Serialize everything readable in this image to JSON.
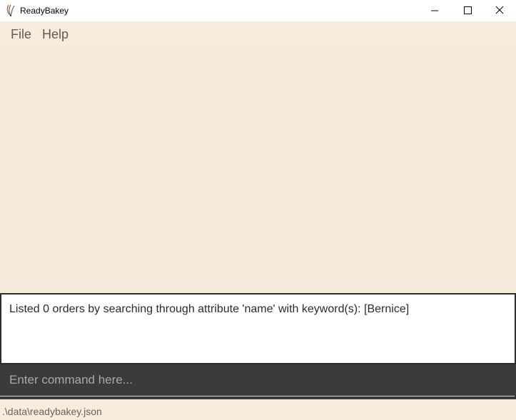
{
  "window": {
    "title": "ReadyBakey",
    "icon": "whisk-icon",
    "controls": [
      "minimize-icon",
      "maximize-icon",
      "close-icon"
    ]
  },
  "menu": {
    "file_label": "File",
    "help_label": "Help"
  },
  "result": {
    "message": "Listed 0 orders by searching through attribute 'name' with keyword(s): [Bernice]"
  },
  "command": {
    "value": "",
    "placeholder": "Enter command here..."
  },
  "status": {
    "file_path": ".\\data\\readybakey.json"
  },
  "colors": {
    "background": "#f5ecdc",
    "result_border": "#2e2e2e",
    "command_background": "#3b3b3b",
    "menu_text": "#6b5a4c"
  }
}
